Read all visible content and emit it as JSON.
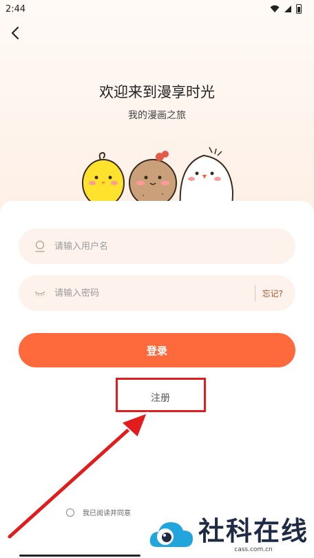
{
  "status_bar": {
    "time": "2:44",
    "icons": [
      "wifi-icon",
      "signal-icon",
      "battery-icon"
    ]
  },
  "header": {
    "back_icon": "chevron-left-icon"
  },
  "welcome": {
    "title": "欢迎来到漫享时光",
    "subtitle": "我的漫画之旅"
  },
  "form": {
    "username": {
      "value": "",
      "placeholder": "请输入用户名",
      "icon": "user-icon"
    },
    "password": {
      "value": "",
      "placeholder": "请输入密码",
      "icon": "eye-closed-icon"
    },
    "forgot_label": "忘记?",
    "login_label": "登录",
    "register_label": "注册",
    "agreement_text": "我已阅读并同意"
  },
  "watermark": {
    "title": "社科在线",
    "subtitle": "cass.com.cn"
  },
  "colors": {
    "accent": "#ff6a3d",
    "field_bg": "#fdf3ec",
    "forgot_text": "#b3522c",
    "annotation_red": "#e11c1c"
  }
}
